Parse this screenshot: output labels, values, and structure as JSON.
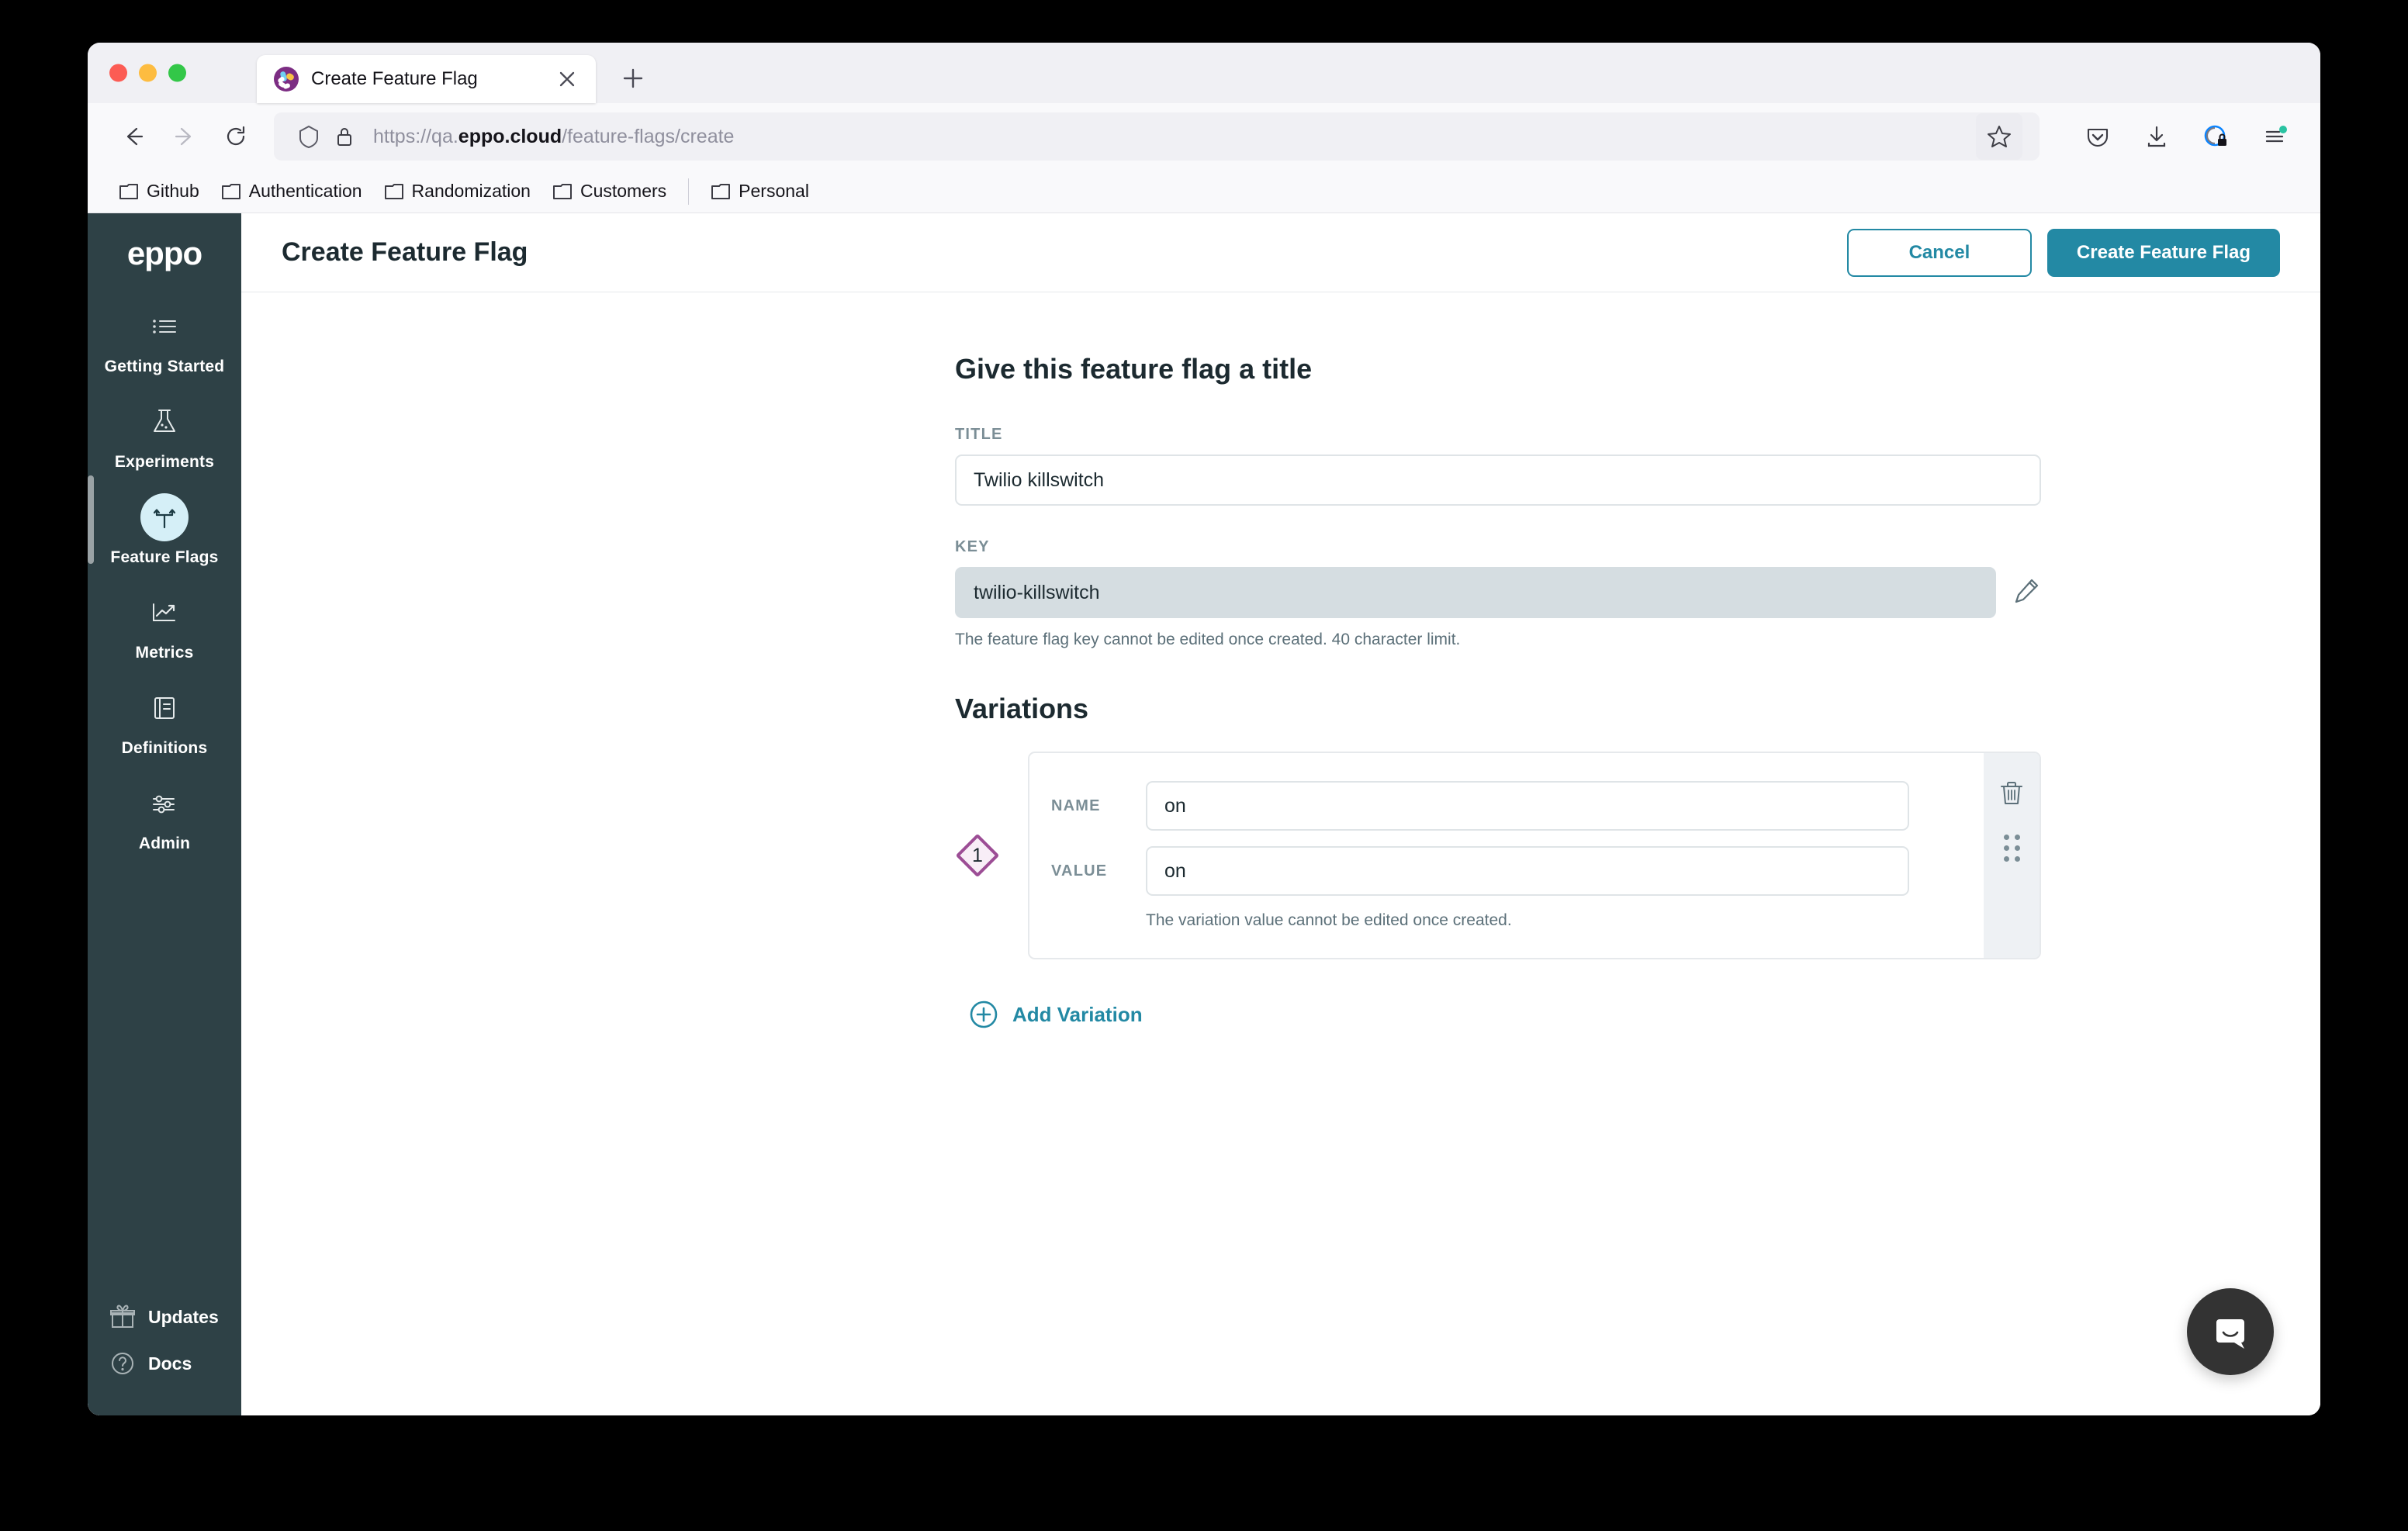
{
  "browser": {
    "tab": {
      "title": "Create Feature Flag",
      "favicon_name": "eppo-favicon"
    },
    "new_tab_label": "+",
    "url": {
      "prefix": "https://qa.",
      "domain": "eppo.cloud",
      "path": "/feature-flags/create"
    },
    "bookmarks": [
      {
        "label": "Github"
      },
      {
        "label": "Authentication"
      },
      {
        "label": "Randomization"
      },
      {
        "label": "Customers"
      },
      {
        "label": "Personal"
      }
    ]
  },
  "sidebar": {
    "logo": "eppo",
    "items": [
      {
        "label": "Getting Started",
        "icon": "list-icon",
        "active": false
      },
      {
        "label": "Experiments",
        "icon": "flask-icon",
        "active": false
      },
      {
        "label": "Feature Flags",
        "icon": "feature-flag-icon",
        "active": true
      },
      {
        "label": "Metrics",
        "icon": "chart-line-icon",
        "active": false
      },
      {
        "label": "Definitions",
        "icon": "book-icon",
        "active": false
      },
      {
        "label": "Admin",
        "icon": "sliders-icon",
        "active": false
      }
    ],
    "bottom_items": [
      {
        "label": "Updates",
        "icon": "gift-icon"
      },
      {
        "label": "Docs",
        "icon": "question-circle-icon"
      }
    ]
  },
  "header": {
    "title": "Create Feature Flag",
    "cancel_label": "Cancel",
    "primary_label": "Create Feature Flag"
  },
  "form": {
    "section_title": "Give this feature flag a title",
    "title_label": "TITLE",
    "title_value": "Twilio killswitch",
    "title_placeholder": "",
    "key_label": "KEY",
    "key_value": "twilio-killswitch",
    "key_helper": "The feature flag key cannot be edited once created. 40 character limit.",
    "edit_key_icon": "pencil-icon"
  },
  "variations": {
    "title": "Variations",
    "add_label": "Add Variation",
    "items": [
      {
        "index": "1",
        "name_label": "NAME",
        "name_value": "on",
        "value_label": "VALUE",
        "value_value": "on",
        "helper": "The variation value cannot be edited once created."
      }
    ]
  },
  "colors": {
    "accent_teal": "#2389a4",
    "sidebar_dark": "#2e4146",
    "active_icon_bg": "#d5eff7",
    "variation_badge": "#9c4d95",
    "disabled_input": "#d5dde1"
  },
  "widgets": {
    "intercom_label": "intercom-messenger"
  }
}
